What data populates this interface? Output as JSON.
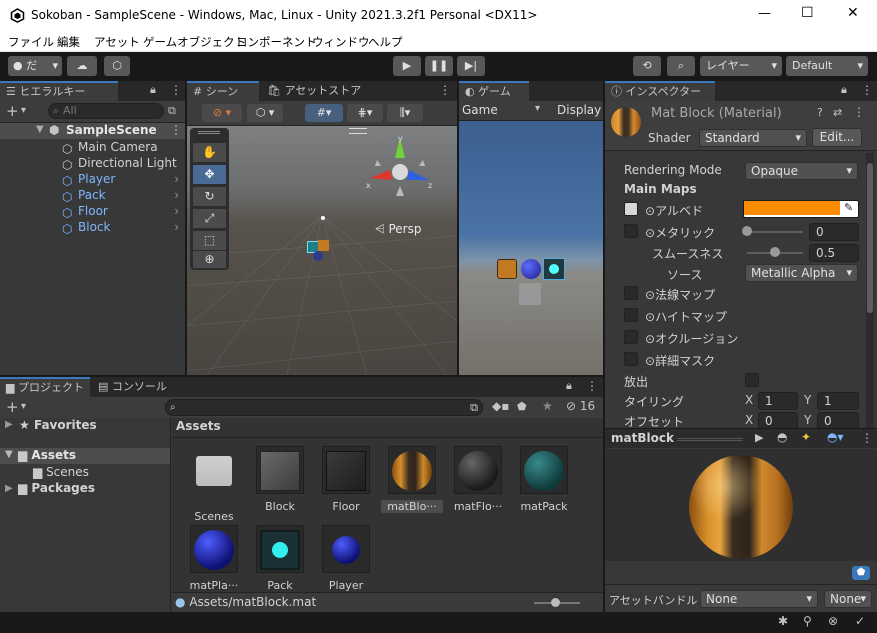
{
  "window": {
    "title": "Sokoban - SampleScene - Windows, Mac, Linux - Unity 2021.3.2f1 Personal <DX11>",
    "minimize": "—",
    "maximize": "☐",
    "close": "✕"
  },
  "menu": [
    "ファイル",
    "編集",
    "アセット",
    "ゲームオブジェクト",
    "コンポーネント",
    "ウィンドウ",
    "ヘルプ"
  ],
  "toolbar": {
    "account_label": "だ",
    "layers_label": "レイヤー",
    "layout_label": "Default"
  },
  "hierarchy": {
    "tab": "ヒエラルキー",
    "search_placeholder": "All",
    "scene": "SampleScene",
    "items": [
      {
        "label": "Main Camera",
        "prefab": false
      },
      {
        "label": "Directional Light",
        "prefab": false
      },
      {
        "label": "Player",
        "prefab": true
      },
      {
        "label": "Pack",
        "prefab": true
      },
      {
        "label": "Floor",
        "prefab": true
      },
      {
        "label": "Block",
        "prefab": true
      }
    ]
  },
  "scene_view": {
    "tab_scene": "シーン",
    "tab_asset_store": "アセットストア",
    "persp": "Persp",
    "gizmo_axes": {
      "x": "x",
      "y": "y",
      "z": "z"
    }
  },
  "game_view": {
    "tab": "ゲーム",
    "display_dropdown": "Game",
    "display_label": "Display"
  },
  "inspector": {
    "tab": "インスペクター",
    "material_name": "Mat Block (Material)",
    "shader_label": "Shader",
    "shader_value": "Standard",
    "edit_button": "Edit...",
    "rendering_mode_label": "Rendering Mode",
    "rendering_mode_value": "Opaque",
    "main_maps": "Main Maps",
    "albedo": "アルベド",
    "albedo_color": "#ff8c00",
    "metallic": "メタリック",
    "metallic_value": "0",
    "metallic_level": 0.0,
    "smoothness": "スムースネス",
    "smoothness_value": "0.5",
    "smoothness_level": 0.5,
    "source": "ソース",
    "source_value": "Metallic Alpha",
    "normal_map": "法線マップ",
    "height_map": "ハイトマップ",
    "occlusion": "オクルージョン",
    "detail_mask": "詳細マスク",
    "emission": "放出",
    "tiling": "タイリング",
    "offset": "オフセット",
    "tiling_x": "1",
    "tiling_y": "1",
    "offset_x": "0",
    "offset_y": "0",
    "x_label": "X",
    "y_label": "Y",
    "preview_title": "matBlock",
    "asset_bundle_label": "アセットバンドル",
    "asset_bundle_value": "None",
    "asset_bundle_variant": "None"
  },
  "project": {
    "tab_project": "プロジェクト",
    "tab_console": "コンソール",
    "hidden_count": "16",
    "favorites": "Favorites",
    "assets": "Assets",
    "scenes": "Scenes",
    "packages": "Packages",
    "breadcrumb": "Assets",
    "path": "Assets/matBlock.mat",
    "items": [
      {
        "label": "Scenes",
        "kind": "folder"
      },
      {
        "label": "Block",
        "kind": "prefab-gray"
      },
      {
        "label": "Floor",
        "kind": "prefab-dark"
      },
      {
        "label": "matBlo···",
        "kind": "mat-block"
      },
      {
        "label": "matFlo···",
        "kind": "mat-floor"
      },
      {
        "label": "matPack",
        "kind": "mat-pack"
      },
      {
        "label": "matPla···",
        "kind": "mat-player"
      },
      {
        "label": "Pack",
        "kind": "prefab-pack"
      },
      {
        "label": "Player",
        "kind": "prefab-player"
      }
    ]
  }
}
